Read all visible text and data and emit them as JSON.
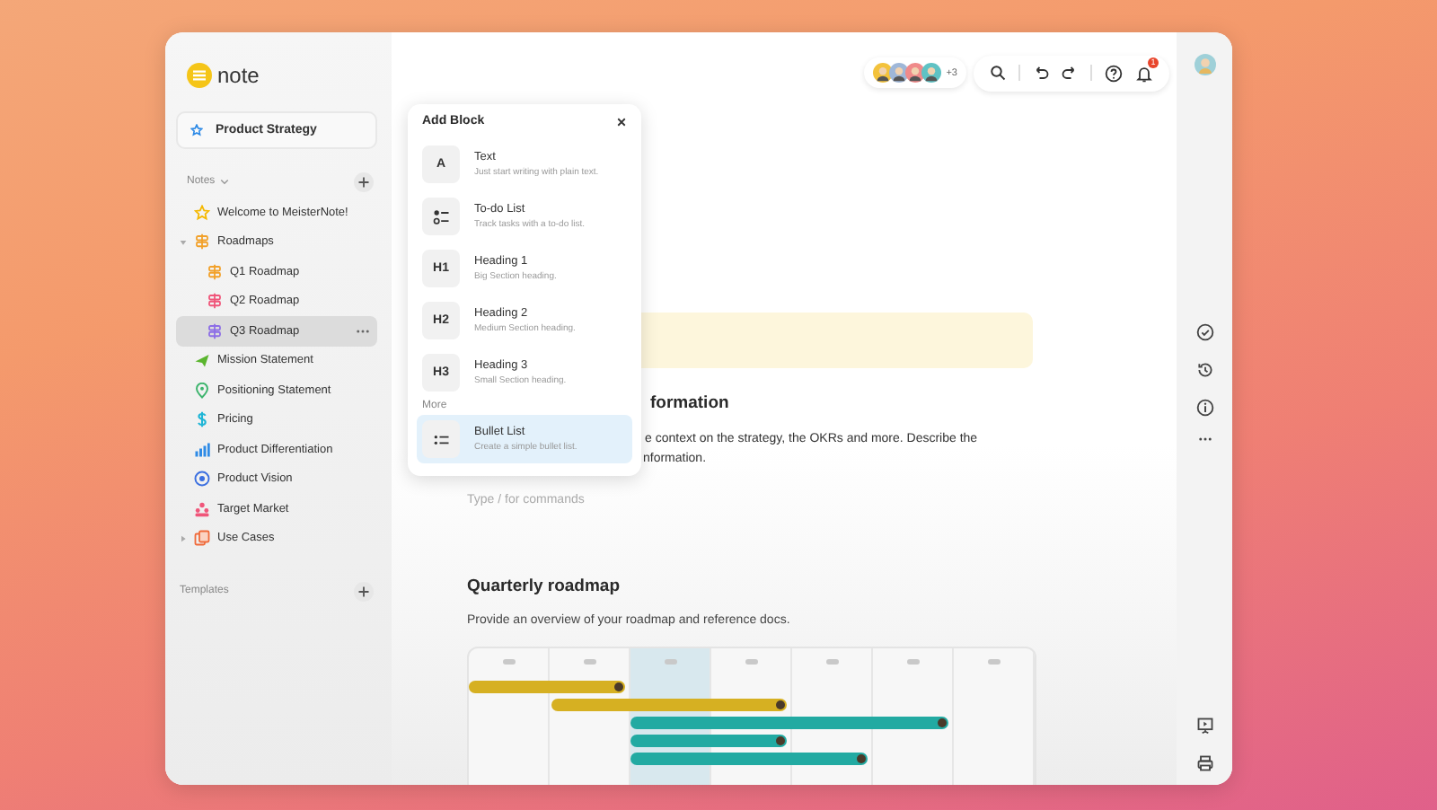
{
  "app": {
    "logo": "note"
  },
  "sidebar": {
    "workspace": "Product Strategy",
    "notes_label": "Notes",
    "templates_label": "Templates",
    "items": [
      {
        "label": "Welcome to MeisterNote!",
        "selected": false
      },
      {
        "label": "Roadmaps",
        "selected": false,
        "expanded": true,
        "children": [
          {
            "label": "Q1 Roadmap",
            "selected": false
          },
          {
            "label": "Q2 Roadmap",
            "selected": false
          },
          {
            "label": "Q3 Roadmap",
            "selected": true
          }
        ]
      },
      {
        "label": "Mission Statement",
        "selected": false
      },
      {
        "label": "Positioning Statement",
        "selected": false
      },
      {
        "label": "Pricing",
        "selected": false
      },
      {
        "label": "Product Differentiation",
        "selected": false
      },
      {
        "label": "Product Vision",
        "selected": false
      },
      {
        "label": "Target Market",
        "selected": false
      },
      {
        "label": "Use Cases",
        "selected": false,
        "expanded": false
      }
    ]
  },
  "topbar": {
    "collaborators_more": "+3",
    "notifications": "1"
  },
  "popup": {
    "title": "Add Block",
    "sections": [
      {
        "items": [
          {
            "kind": "glyph",
            "glyph": "A",
            "title": "Text",
            "description": "Just start writing with plain text.",
            "selected": false
          },
          {
            "kind": "todo",
            "title": "To-do List",
            "description": "Track tasks with a to-do list.",
            "selected": false
          },
          {
            "kind": "glyph",
            "glyph": "H1",
            "title": "Heading 1",
            "description": "Big Section heading.",
            "selected": false
          },
          {
            "kind": "glyph",
            "glyph": "H2",
            "title": "Heading 2",
            "description": "Medium Section heading.",
            "selected": false
          },
          {
            "kind": "glyph",
            "glyph": "H3",
            "title": "Heading 3",
            "description": "Small Section heading.",
            "selected": false
          }
        ]
      },
      {
        "label": "More",
        "items": [
          {
            "kind": "bullet",
            "title": "Bullet List",
            "description": "Create a simple bullet list.",
            "selected": true
          }
        ]
      }
    ]
  },
  "document": {
    "heading_fragment": "formation",
    "paragraph_lines": [
      "e context on the strategy, the OKRs and more. Describe the",
      "nformation."
    ],
    "editor": {
      "placeholder": "Type / for commands"
    },
    "section_heading": "Quarterly roadmap",
    "section_description": "Provide an overview of your roadmap and reference docs.",
    "timeline": {
      "columns": [
        {
          "selected": false
        },
        {
          "selected": false
        },
        {
          "selected": true
        },
        {
          "selected": false
        },
        {
          "selected": false
        },
        {
          "selected": false
        },
        {
          "selected": false
        }
      ]
    }
  }
}
